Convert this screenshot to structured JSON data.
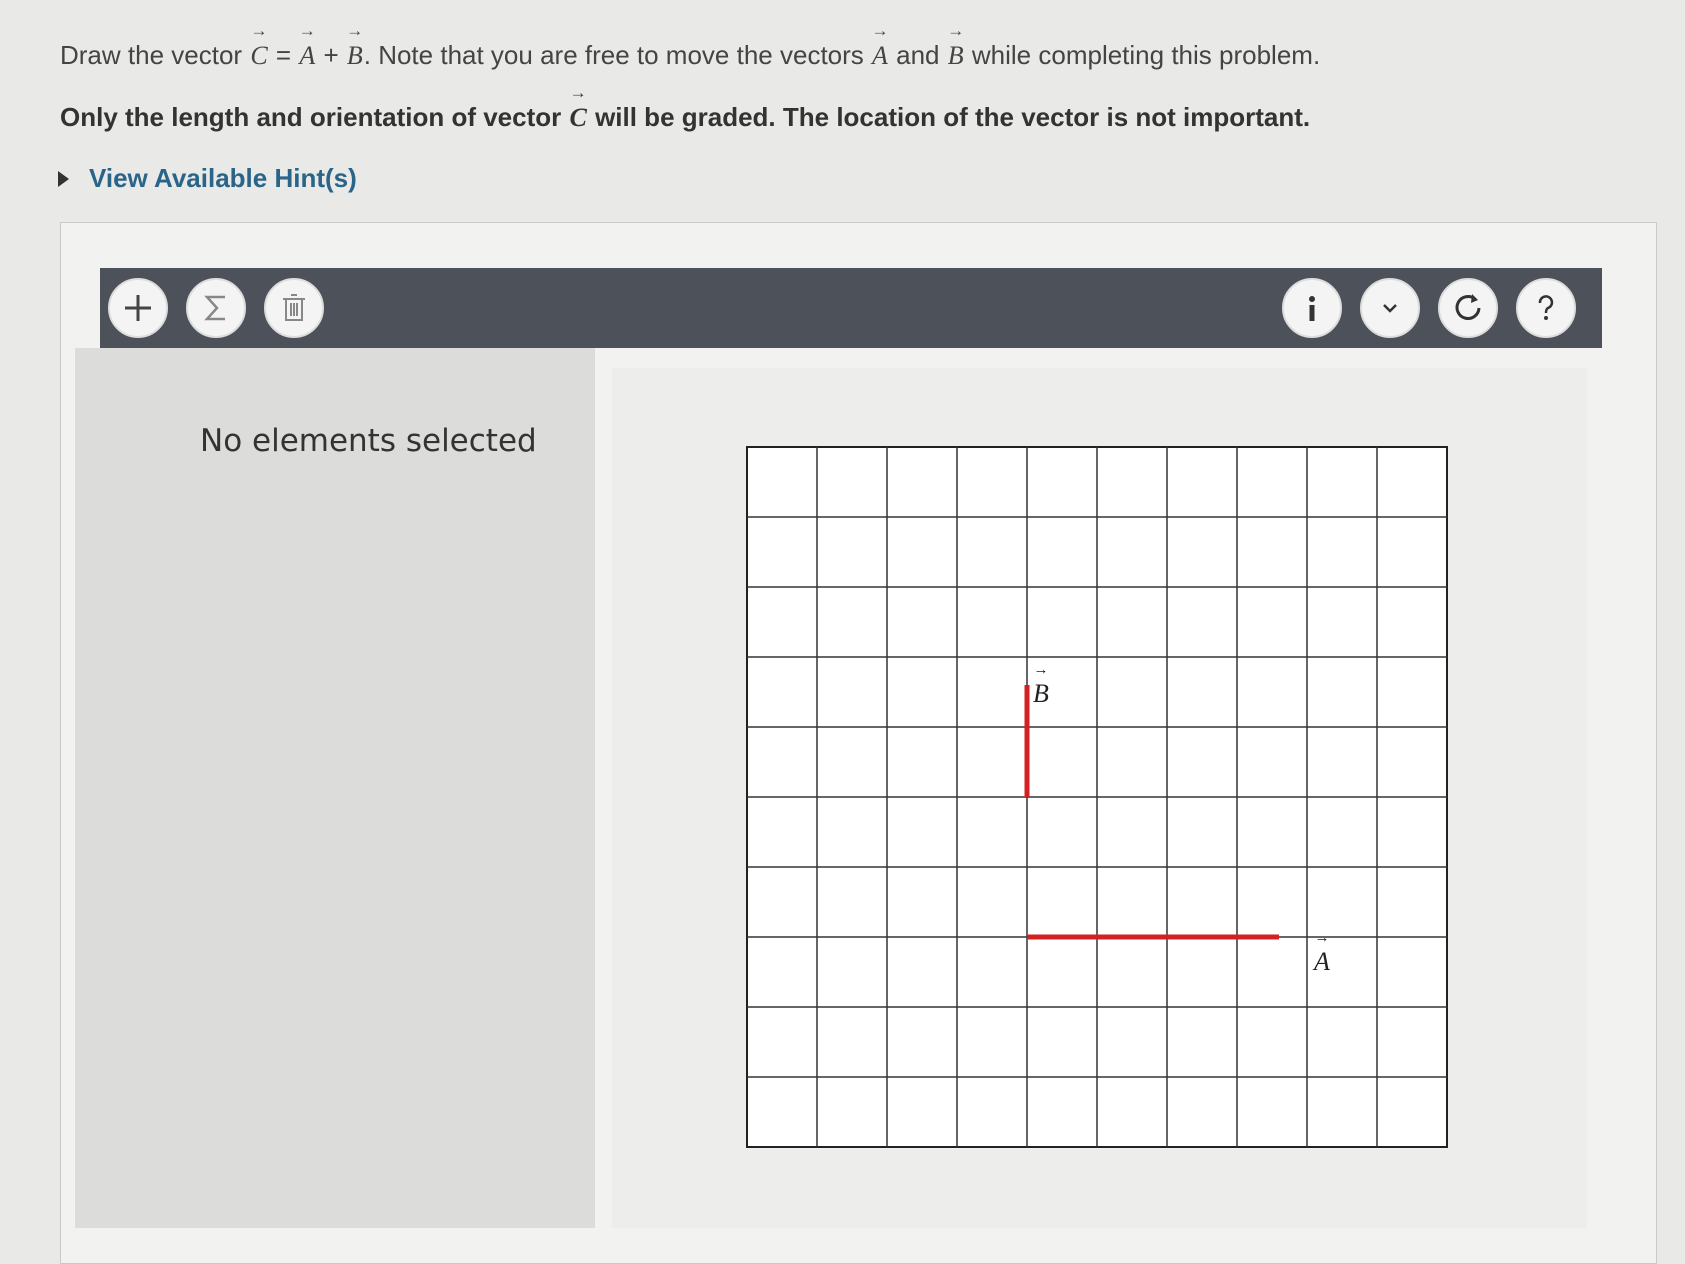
{
  "problem": {
    "prompt_prefix": "Draw the vector",
    "vec_c": "C",
    "equals": "=",
    "vec_a": "A",
    "plus": "+",
    "vec_b": "B",
    "prompt_middle": ". Note that you are free to move the vectors",
    "prompt_and": "and",
    "prompt_suffix": "while completing this problem.",
    "instruction_prefix": "Only the length and orientation of vector",
    "instruction_suffix": "will be graded. The location of the vector is not important."
  },
  "hint": {
    "label": "View Available Hint(s)"
  },
  "toolbar": {
    "left_icons": [
      "plus-icon",
      "sigma-icon",
      "trash-icon"
    ],
    "right_icons": [
      "info-icon",
      "chevron-down-icon",
      "reset-icon",
      "help-icon"
    ]
  },
  "sidebar": {
    "status": "No elements selected"
  },
  "graph": {
    "cols": 10,
    "rows": 10,
    "vector_color": "#d42020",
    "vectors": [
      {
        "name": "A",
        "label": "A",
        "dx": 3.6,
        "dy": 0
      },
      {
        "name": "B",
        "label": "B",
        "dx": 0,
        "dy": 1.6
      }
    ]
  }
}
